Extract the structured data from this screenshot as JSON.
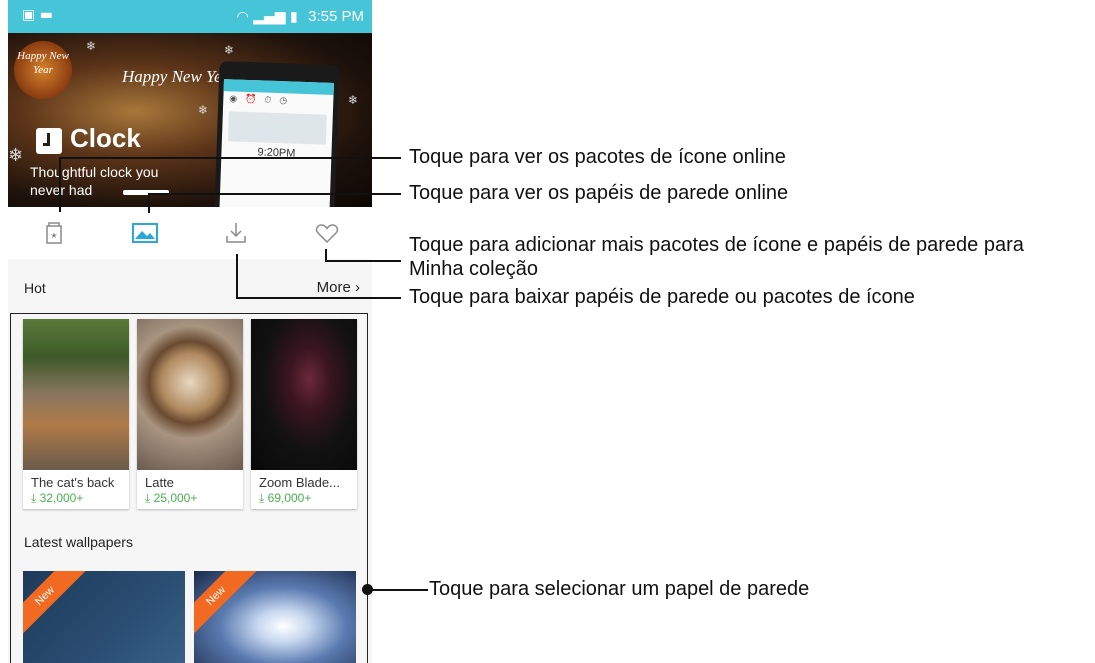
{
  "status_bar": {
    "time": "3:55 PM",
    "left_icons": [
      "notification-icon",
      "image-icon"
    ],
    "right_icons": [
      "wifi-icon",
      "signal-icon",
      "battery-icon"
    ]
  },
  "banner": {
    "badge_text": "Happy New Year",
    "greeting": "Happy New Year",
    "app_title": "Clock",
    "tagline": "Thoughtful clock you never had",
    "device_time": "9:20PM"
  },
  "tabs": [
    {
      "name": "icon-packs",
      "icon": "icon-pack-icon",
      "active": false
    },
    {
      "name": "wallpapers",
      "icon": "image-icon",
      "active": true
    },
    {
      "name": "downloads",
      "icon": "download-icon",
      "active": false
    },
    {
      "name": "favorites",
      "icon": "heart-icon",
      "active": false
    }
  ],
  "hot": {
    "title": "Hot",
    "more": "More",
    "items": [
      {
        "name": "The cat's back",
        "downloads": "32,000+"
      },
      {
        "name": "Latte",
        "downloads": "25,000+"
      },
      {
        "name": "Zoom Blade...",
        "downloads": "69,000+"
      }
    ]
  },
  "latest": {
    "title": "Latest wallpapers",
    "items": [
      {
        "badge": "New"
      },
      {
        "badge": "New"
      }
    ]
  },
  "callouts": {
    "icon_packs": "Toque para ver os pacotes de ícone online",
    "wallpapers": "Toque para ver os papéis de parede online",
    "favorites_line1": "Toque para adicionar mais pacotes de ícone e papéis de parede para",
    "favorites_line2": "Minha coleção",
    "downloads": "Toque para baixar papéis de parede ou pacotes de ícone",
    "select": "Toque para selecionar um papel de parede"
  },
  "colors": {
    "accent": "#46c4d8",
    "download_green": "#4caf50",
    "new_badge": "#f26a21"
  }
}
